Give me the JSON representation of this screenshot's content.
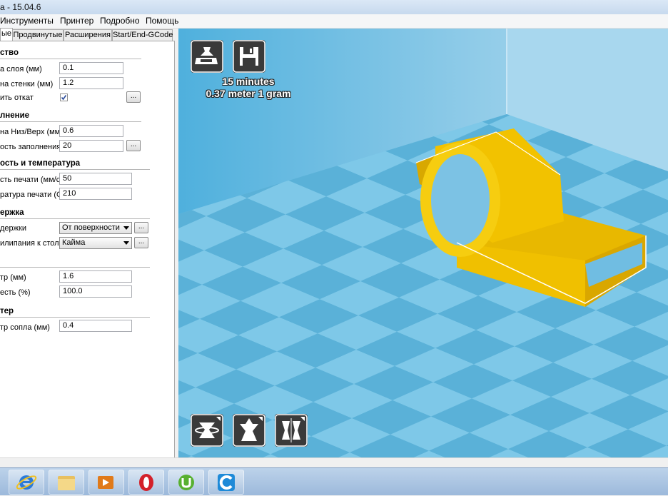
{
  "window": {
    "title": "a - 15.04.6"
  },
  "menu": [
    "Инструменты",
    "Принтер",
    "Подробно",
    "Помощь"
  ],
  "tabs": [
    "ые",
    "Продвинутые",
    "Расширения",
    "Start/End-GCode"
  ],
  "sections": {
    "quality": {
      "title": "ство",
      "layer_height": {
        "label": "а слоя (мм)",
        "value": "0.1"
      },
      "wall_thickness": {
        "label": "на стенки (мм)",
        "value": "1.2"
      },
      "retraction": {
        "label": "ить откат",
        "checked": true,
        "more": "..."
      }
    },
    "fill": {
      "title": "лнение",
      "bottom_top": {
        "label": "на Низ/Верх (мм)",
        "value": "0.6"
      },
      "density": {
        "label": "ость заполнения",
        "value": "20",
        "more": "..."
      }
    },
    "speed": {
      "title": "ость и температура",
      "print_speed": {
        "label": "сть печати (мм/с)",
        "value": "50"
      },
      "print_temp": {
        "label": "ратура печати (С)",
        "value": "210"
      }
    },
    "support": {
      "title": "ержка",
      "support_type": {
        "label": "держки",
        "value": "От поверхности",
        "more": "..."
      },
      "adhesion": {
        "label": "илипания к столу",
        "value": "Кайма",
        "more": "..."
      }
    },
    "filament": {
      "title": "",
      "diameter": {
        "label": "тр (мм)",
        "value": "1.6"
      },
      "flow": {
        "label": "есть (%)",
        "value": "100.0"
      }
    },
    "machine": {
      "title": "тер",
      "nozzle": {
        "label": "тр сопла (мм)",
        "value": "0.4"
      }
    }
  },
  "viewport": {
    "print_time": "15 minutes",
    "print_material": "0.37 meter 1 gram",
    "colors": {
      "floor_light": "#7ec8e8",
      "floor_dark": "#5ab1d8",
      "model": "#f2c200",
      "wall": "#9fd3ec"
    }
  },
  "taskbar": [
    "ie-icon",
    "explorer-icon",
    "media-player-icon",
    "opera-icon",
    "utorrent-icon",
    "ccleaner-icon"
  ]
}
